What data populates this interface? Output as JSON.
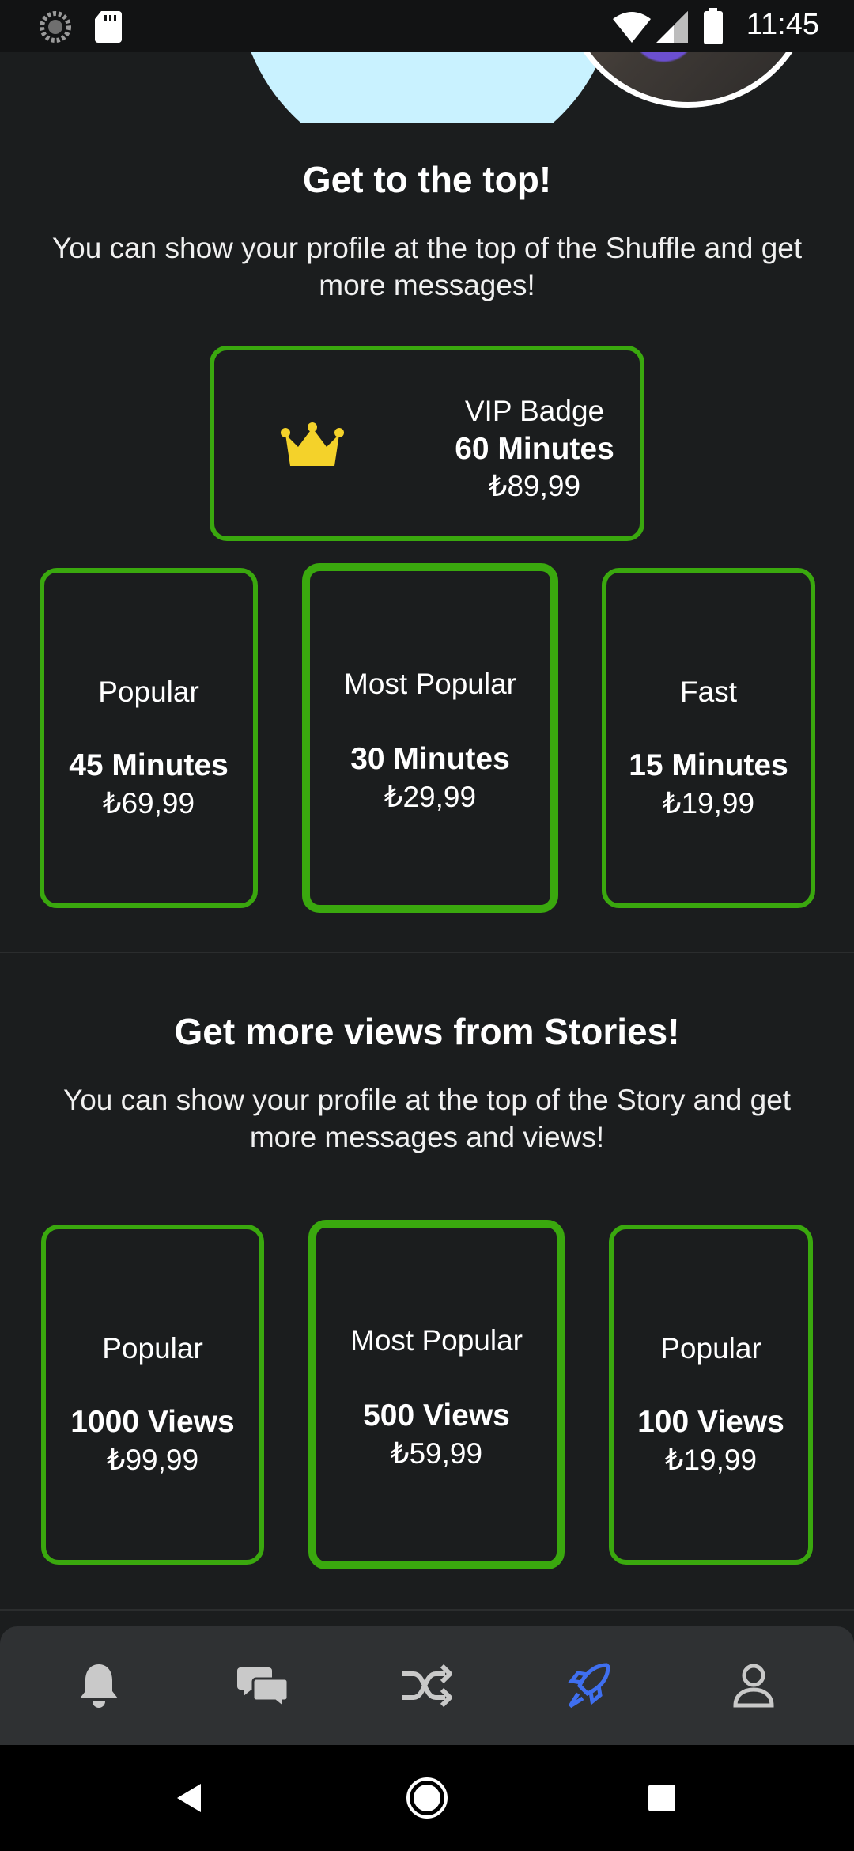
{
  "status_bar": {
    "time": "11:45",
    "icons": [
      "loading-icon",
      "sd-card-icon",
      "wifi-icon",
      "signal-icon",
      "battery-icon"
    ]
  },
  "top_section": {
    "title": "Get to the top!",
    "description": "You can show your profile at the top of the Shuffle and get more messages!",
    "vip": {
      "icon": "crown-icon",
      "label": "VIP Badge",
      "amount": "60 Minutes",
      "price": "₺89,99"
    },
    "cards": [
      {
        "label": "Popular",
        "amount": "45 Minutes",
        "price": "₺69,99"
      },
      {
        "label": "Most Popular",
        "amount": "30 Minutes",
        "price": "₺29,99"
      },
      {
        "label": "Fast",
        "amount": "15 Minutes",
        "price": "₺19,99"
      }
    ]
  },
  "stories_section": {
    "title": "Get more views from Stories!",
    "description": "You can show your profile at the top of the Story and get more messages and views!",
    "cards": [
      {
        "label": "Popular",
        "amount": "1000 Views",
        "price": "₺99,99"
      },
      {
        "label": "Most Popular",
        "amount": "500 Views",
        "price": "₺59,99"
      },
      {
        "label": "Popular",
        "amount": "100 Views",
        "price": "₺19,99"
      }
    ]
  },
  "bottom_nav": {
    "items": [
      "bell-icon",
      "chat-icon",
      "shuffle-icon",
      "rocket-icon",
      "profile-icon"
    ],
    "active": "rocket-icon"
  },
  "colors": {
    "background": "#1b1d1e",
    "card_border": "#3aa80e",
    "active_nav": "#3f6ff0",
    "inactive_nav": "#c9c9c9",
    "crown": "#f4d22a"
  }
}
